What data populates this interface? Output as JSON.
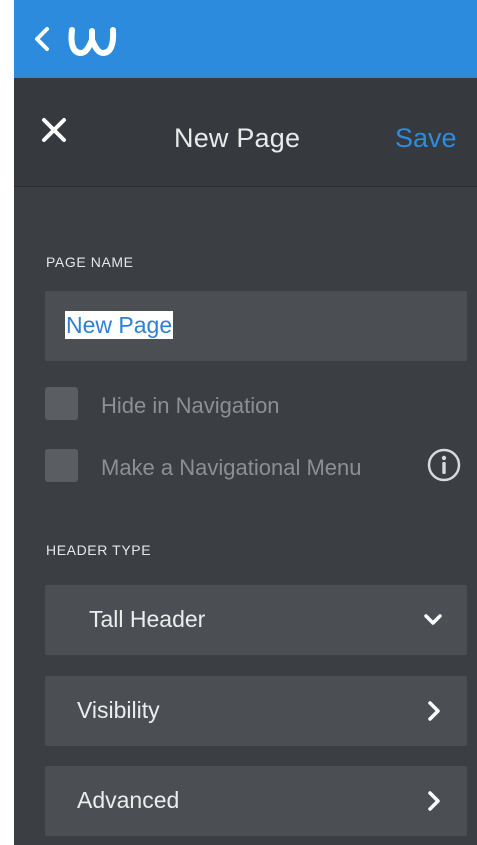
{
  "topbar": {
    "back_icon": "chevron-left-icon",
    "logo_icon": "weebly-logo-icon",
    "accent_color": "#2d8bde"
  },
  "header": {
    "close_icon": "close-icon",
    "title": "New Page",
    "save_label": "Save",
    "save_color": "#2f8be0"
  },
  "page_name": {
    "section_label": "PAGE NAME",
    "value": "New Page"
  },
  "options": {
    "hide_in_navigation": {
      "label": "Hide in Navigation",
      "checked": false
    },
    "make_nav_menu": {
      "label": "Make a Navigational Menu",
      "checked": false,
      "info_icon": "info-icon"
    }
  },
  "header_type": {
    "section_label": "HEADER TYPE",
    "selected": "Tall Header",
    "icon": "chevron-down-icon"
  },
  "rows": {
    "visibility": {
      "label": "Visibility",
      "icon": "chevron-right-icon"
    },
    "advanced": {
      "label": "Advanced",
      "icon": "chevron-right-icon"
    }
  }
}
